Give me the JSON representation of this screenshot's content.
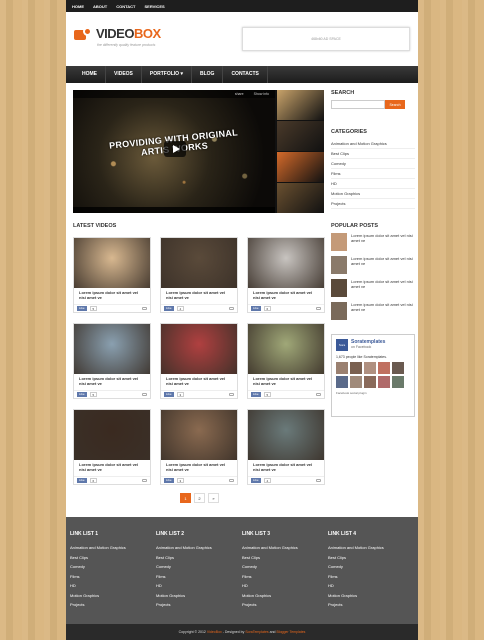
{
  "topbar": [
    "HOME",
    "ABOUT",
    "CONTACT",
    "SERVICES"
  ],
  "logo": {
    "main": "VIDEO",
    "accent": "BOX",
    "tagline": "the differently quality feature products"
  },
  "ad_text": "468x60 AD SPACE",
  "nav": [
    "HOME",
    "VIDEOS",
    "PORTFOLIO ▾",
    "BLOG",
    "CONTACTS"
  ],
  "hero": {
    "text_line1": "PROVIDING WITH ORIGINAL",
    "text_line2": "ARTIS  WORKS",
    "share": "share",
    "info": "Show info",
    "thumb_colors": [
      "#c9a36a",
      "#4a3a2a",
      "#d46a2a",
      "#6a5030"
    ]
  },
  "sidebar": {
    "search_title": "SEARCH",
    "search_btn": "Search",
    "categories_title": "CATEGORIES",
    "categories": [
      "Animation and Motion Graphics",
      "Best Clips",
      "Comedy",
      "Films",
      "HD",
      "Motion Graphics",
      "Projects"
    ],
    "popular_title": "POPULAR POSTS",
    "popular": [
      {
        "text": "Lorem ipsum dolor sit amet vel nisi amet ve",
        "color": "#c49a78"
      },
      {
        "text": "Lorem ipsum dolor sit amet vel nisi amet ve",
        "color": "#8a7a6a"
      },
      {
        "text": "Lorem ipsum dolor sit amet vel nisi amet ve",
        "color": "#5a4a3a"
      },
      {
        "text": "Lorem ipsum dolor sit amet vel nisi amet ve",
        "color": "#7a6a5a"
      }
    ]
  },
  "facebook": {
    "name": "Soratemplates",
    "on": "on Facebook",
    "likes": "1,673 people like Soratemplates.",
    "foot": "Facebook social plugin",
    "face_colors": [
      "#9a8070",
      "#7a6050",
      "#b09080",
      "#c07060",
      "#6a5a50",
      "#5a6a8a",
      "#a08a7a",
      "#8a6a5a",
      "#b06a6a",
      "#6a7a6a"
    ]
  },
  "latest_title": "LATEST VIDEOS",
  "cards": [
    {
      "text": "Lorem ipsum dolor sit amet vel nisi amet ve",
      "like": "Like",
      "count": "5",
      "color": "#d8b890"
    },
    {
      "text": "Lorem ipsum dolor sit amet vel nisi amet ve",
      "like": "Like",
      "count": "4",
      "color": "#5a4a3a"
    },
    {
      "text": "Lorem ipsum dolor sit amet vel nisi amet ve",
      "like": "Like",
      "count": "6",
      "color": "#c8c4c0"
    },
    {
      "text": "Lorem ipsum dolor sit amet vel nisi amet ve",
      "like": "Like",
      "count": "5",
      "color": "#8aa0b0"
    },
    {
      "text": "Lorem ipsum dolor sit amet vel nisi amet ve",
      "like": "Like",
      "count": "3",
      "color": "#b04040"
    },
    {
      "text": "Lorem ipsum dolor sit amet vel nisi amet ve",
      "like": "Like",
      "count": "5",
      "color": "#a0a878"
    },
    {
      "text": "Lorem ipsum dolor sit amet vel nisi amet ve",
      "like": "Like",
      "count": "6",
      "color": "#3a2a20"
    },
    {
      "text": "Lorem ipsum dolor sit amet vel nisi amet ve",
      "like": "Like",
      "count": "3",
      "color": "#8a6a50"
    },
    {
      "text": "Lorem ipsum dolor sit amet vel nisi amet ve",
      "like": "Like",
      "count": "4",
      "color": "#6a7a7a"
    }
  ],
  "pager": [
    "1",
    "2",
    "»"
  ],
  "footer": [
    {
      "title": "LINK LIST 1",
      "items": [
        "Animation and Motion Graphics",
        "Best Clips",
        "Comedy",
        "Films",
        "HD",
        "Motion Graphics",
        "Projects"
      ]
    },
    {
      "title": "LINK LIST 2",
      "items": [
        "Animation and Motion Graphics",
        "Best Clips",
        "Comedy",
        "Films",
        "HD",
        "Motion Graphics",
        "Projects"
      ]
    },
    {
      "title": "LINK LIST 3",
      "items": [
        "Animation and Motion Graphics",
        "Best Clips",
        "Comedy",
        "Films",
        "HD",
        "Motion Graphics",
        "Projects"
      ]
    },
    {
      "title": "LINK LIST 4",
      "items": [
        "Animation and Motion Graphics",
        "Best Clips",
        "Comedy",
        "Films",
        "HD",
        "Motion Graphics",
        "Projects"
      ]
    }
  ],
  "copyright": {
    "pre": "Copyright © 2012 ",
    "site": "VideoBox",
    "mid": " - Designed by ",
    "a1": "SoraTemplates",
    "and": " and ",
    "a2": "Blogger Templates"
  }
}
